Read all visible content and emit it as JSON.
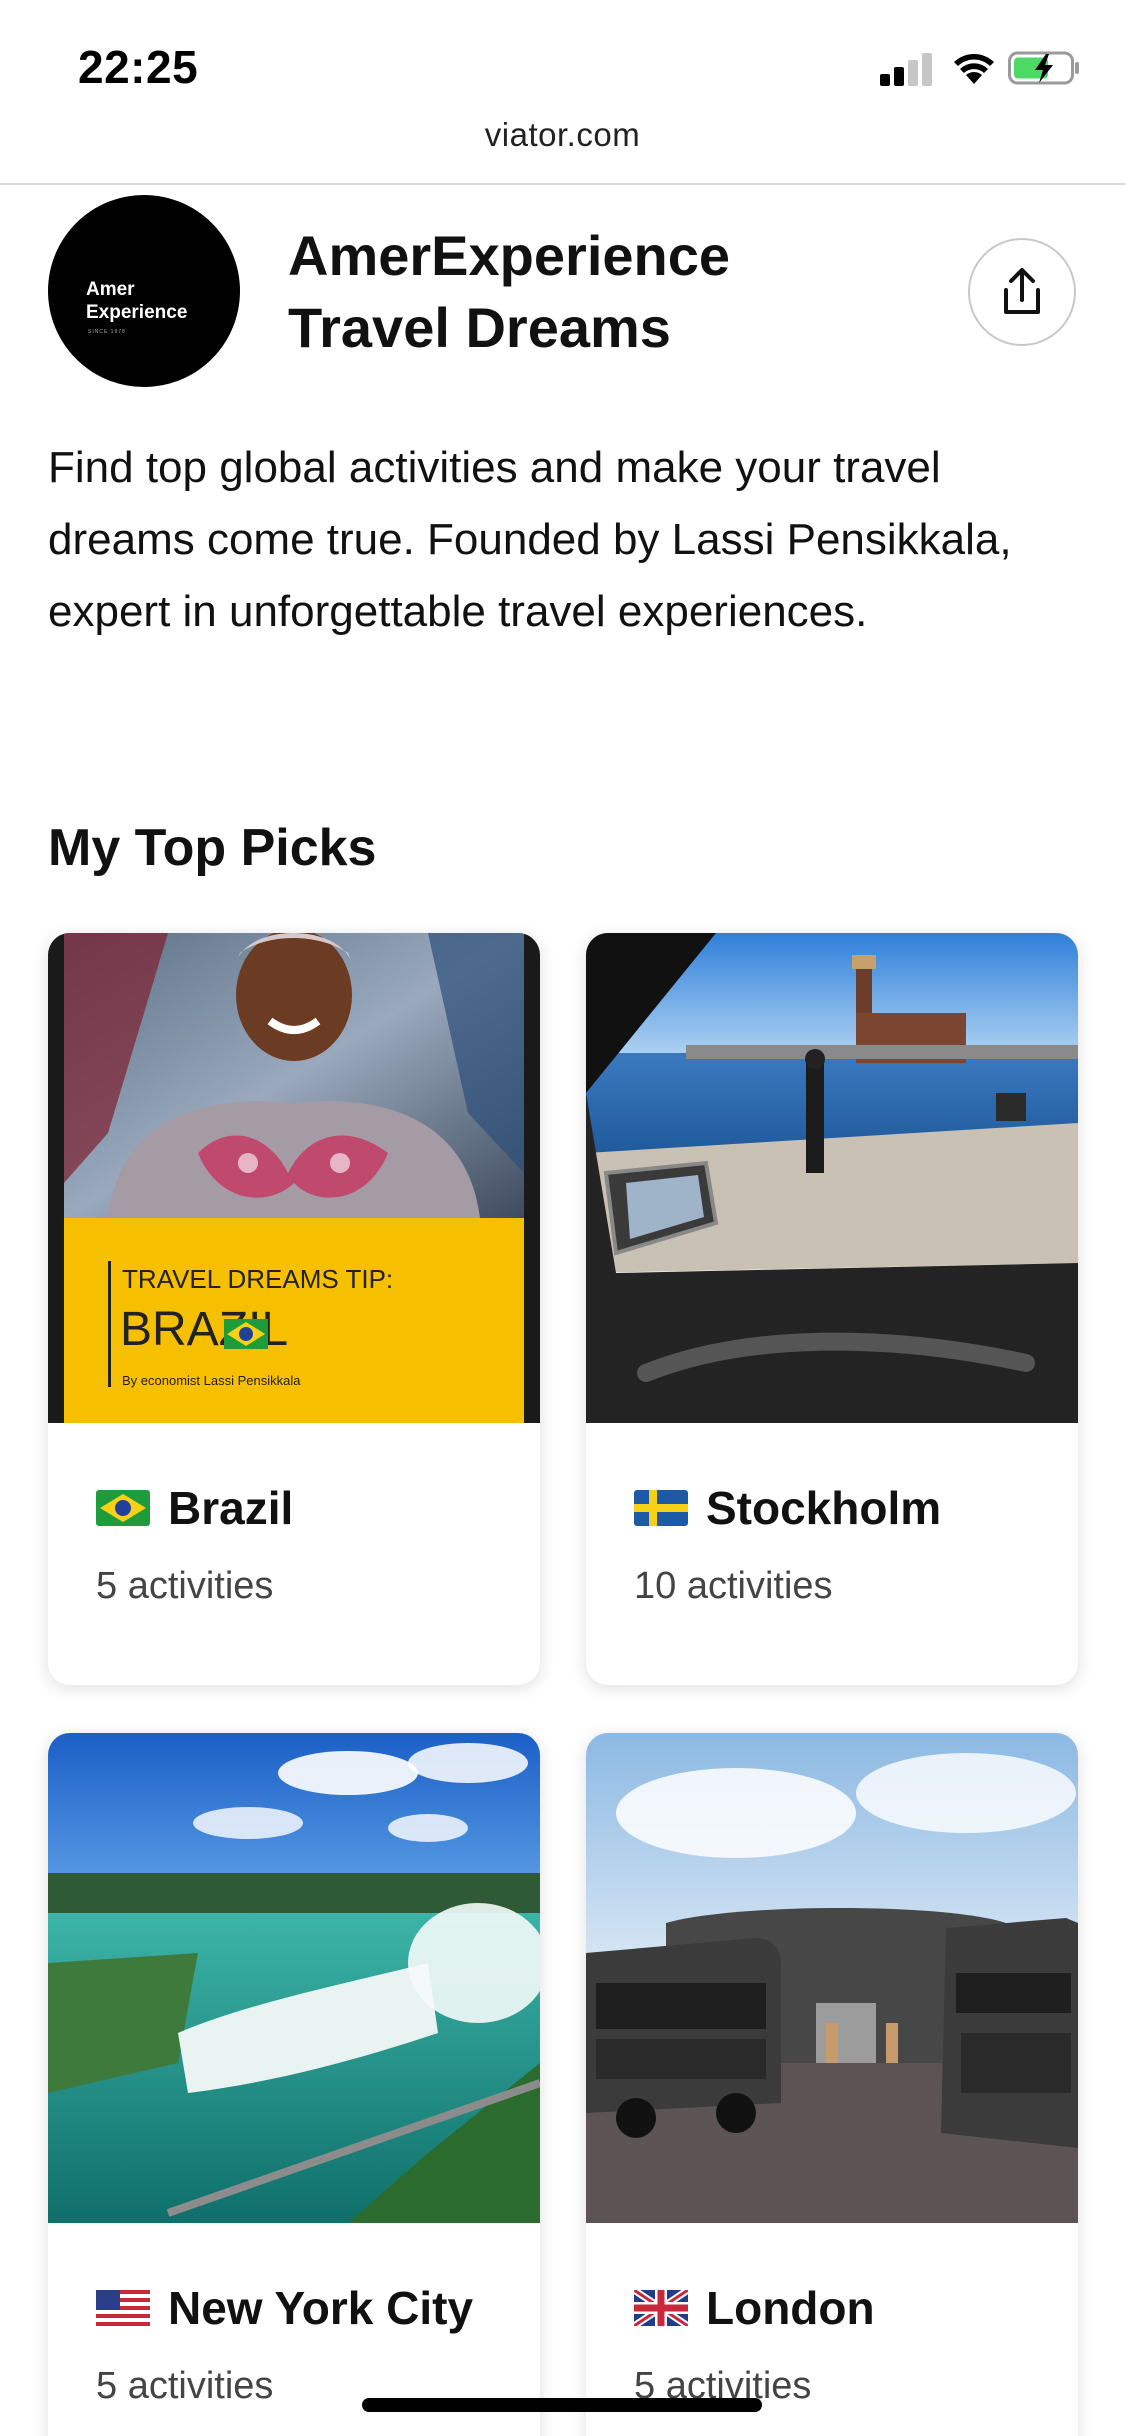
{
  "status_bar": {
    "time": "22:25"
  },
  "browser": {
    "url": "viator.com"
  },
  "profile": {
    "avatar_line1": "Amer",
    "avatar_line2": "Experience",
    "avatar_tagline": "SINCE 1978",
    "name_line1": "AmerExperience",
    "name_line2": "Travel Dreams",
    "description": "Find top global activities and make your travel dreams come true. Founded by Lassi Pensikkala, expert in unforgettable travel experiences."
  },
  "top_picks": {
    "title": "My Top Picks",
    "items": [
      {
        "name": "Brazil",
        "count": "5 activities",
        "flag": "brazil-flag",
        "image_caption_line1": "TRAVEL DREAMS TIP:",
        "image_caption_line2": "BRAZIL",
        "image_caption_line3": "By economist Lassi Pensikkala"
      },
      {
        "name": "Stockholm",
        "count": "10 activities",
        "flag": "sweden-flag"
      },
      {
        "name": "New York City",
        "count": "5 activities",
        "flag": "usa-flag"
      },
      {
        "name": "London",
        "count": "5 activities",
        "flag": "uk-flag"
      }
    ]
  },
  "colors": {
    "accent_yellow": "#f6c000",
    "text_dark": "#111111",
    "text_muted": "#444444"
  }
}
